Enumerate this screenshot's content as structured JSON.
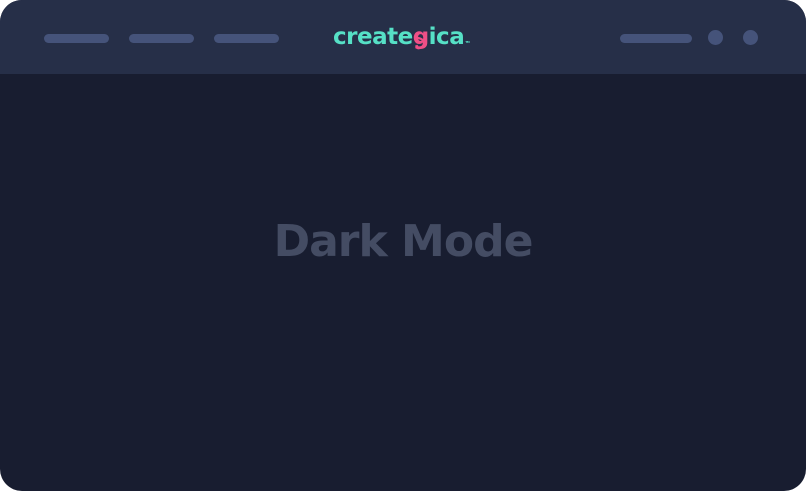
{
  "header": {
    "logo": {
      "part1": "create",
      "part2": "g",
      "part3": "ica",
      "mark": "TM"
    }
  },
  "main": {
    "title": "Dark Mode"
  },
  "colors": {
    "window_background": "#181d30",
    "header_background": "#262f48",
    "placeholder": "#45537a",
    "logo_teal": "#56e0c6",
    "logo_pink": "#ef4f86",
    "title_text": "#444c63"
  }
}
